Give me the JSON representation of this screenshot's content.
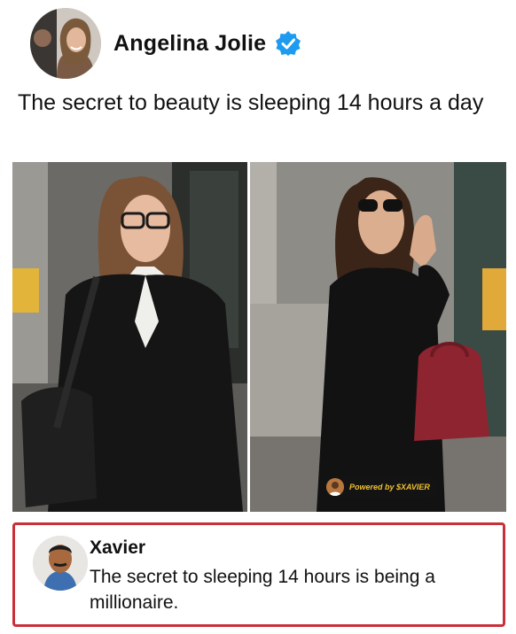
{
  "post": {
    "author_name": "Angelina Jolie",
    "verified_icon": "verified-badge-icon",
    "text": "The secret to beauty is sleeping 14 hours a day"
  },
  "photos": {
    "watermark": "Powered by $XAVIER"
  },
  "reply": {
    "name": "Xavier",
    "text": "The secret to sleeping 14 hours is being a millionaire.",
    "border_color": "#c8313a"
  },
  "colors": {
    "verified_blue": "#1d9bf0"
  }
}
